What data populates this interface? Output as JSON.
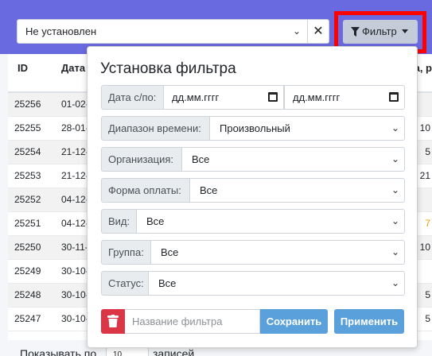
{
  "toolbar": {
    "status_select_value": "Не установлен",
    "clear_label": "✕",
    "filter_button_label": "Фильтр"
  },
  "table": {
    "headers": [
      "ID",
      "Дата",
      "a, р"
    ],
    "rows": [
      {
        "id": "25256",
        "date": "01-02-",
        "tail": ""
      },
      {
        "id": "25255",
        "date": "28-01-",
        "tail": "10"
      },
      {
        "id": "25254",
        "date": "21-12-",
        "tail": "5"
      },
      {
        "id": "25253",
        "date": "21-12-",
        "tail": "21"
      },
      {
        "id": "25252",
        "date": "04-12-",
        "tail": ""
      },
      {
        "id": "25251",
        "date": "04-12-",
        "tail": "7"
      },
      {
        "id": "25250",
        "date": "30-11-",
        "tail": "10"
      },
      {
        "id": "25249",
        "date": "30-10-",
        "tail": ""
      },
      {
        "id": "25248",
        "date": "30-10-",
        "tail": "5"
      },
      {
        "id": "25247",
        "date": "30-10-",
        "tail": "5"
      }
    ]
  },
  "footer": {
    "show_label": "Показывать по",
    "page_size": "10",
    "records_label": "записей"
  },
  "popup": {
    "title": "Установка фильтра",
    "date_label": "Дата с/по:",
    "date_from": "дд.мм.гггг",
    "date_to": "дд.мм.гггг",
    "time_range_label": "Диапазон времени:",
    "time_range_value": "Произвольный",
    "org_label": "Организация:",
    "org_value": "Все",
    "payment_label": "Форма оплаты:",
    "payment_value": "Все",
    "kind_label": "Вид:",
    "kind_value": "Все",
    "group_label": "Группа:",
    "group_value": "Все",
    "status_label": "Статус:",
    "status_value": "Все",
    "name_placeholder": "Название фильтра",
    "save_label": "Сохранить",
    "apply_label": "Применить"
  }
}
